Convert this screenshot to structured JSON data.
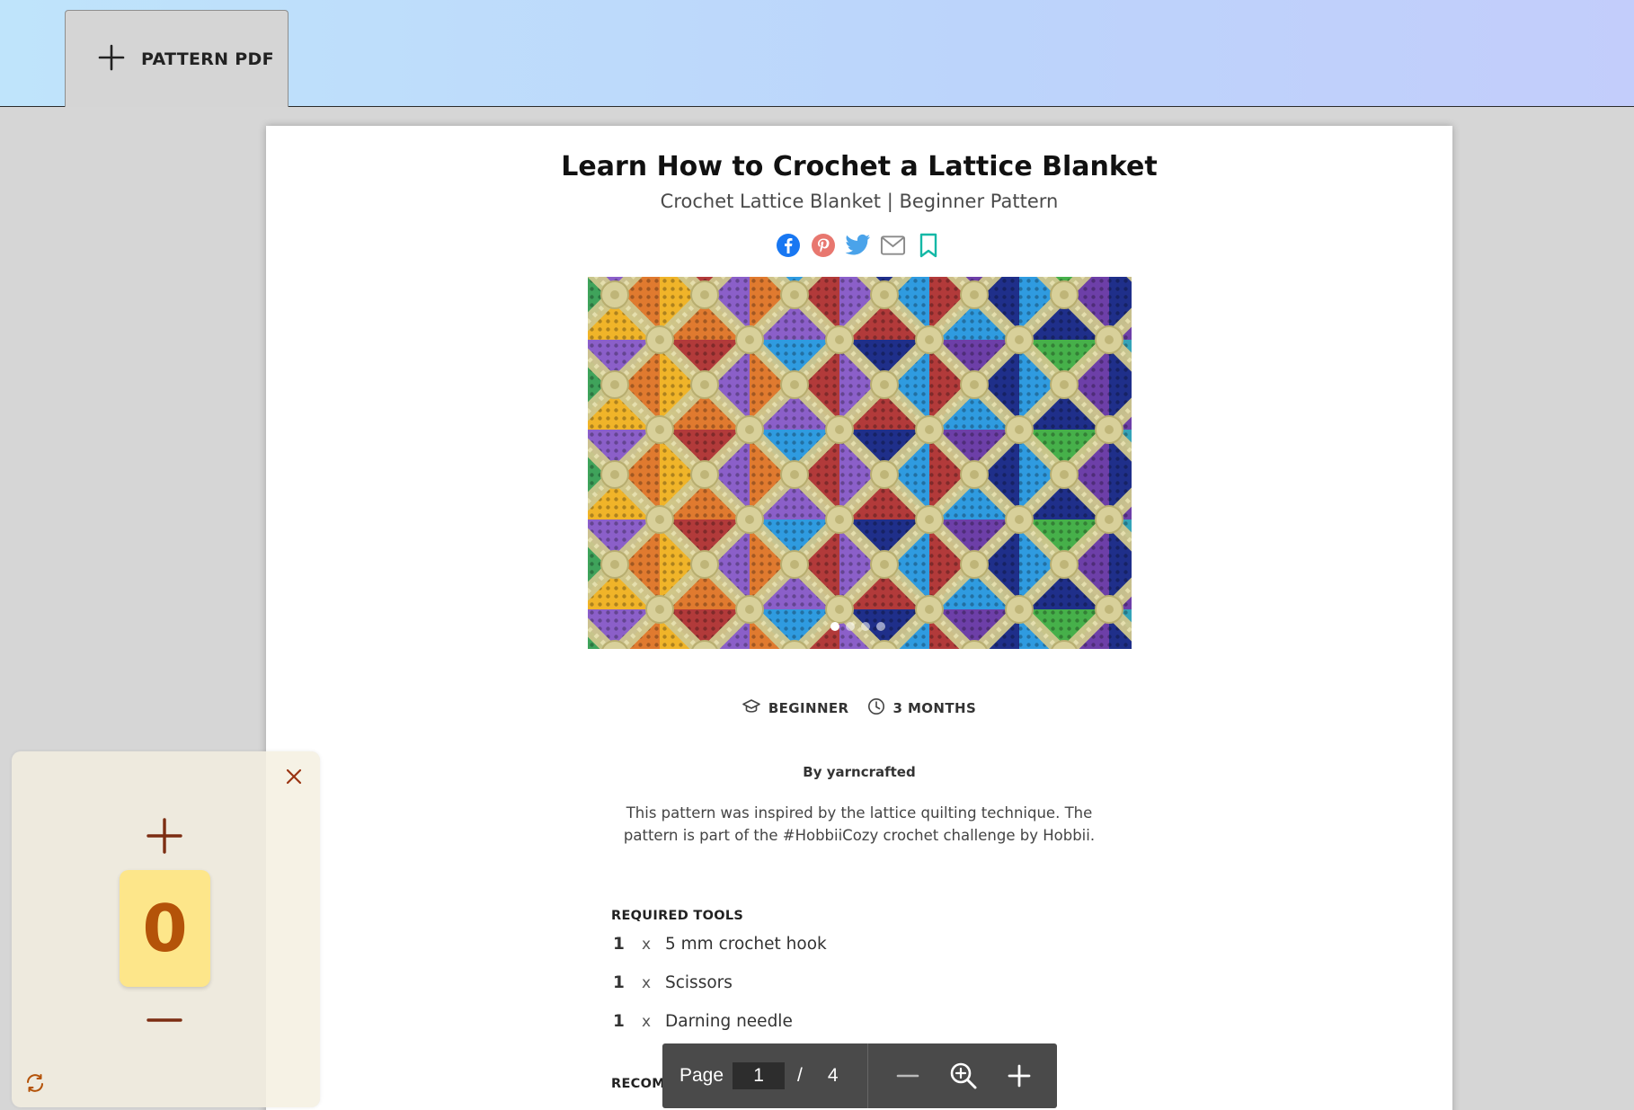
{
  "topbar": {
    "tab_label": "PATTERN PDF",
    "tab_icon": "plus-icon"
  },
  "document": {
    "title": "Learn How to Crochet a Lattice Blanket",
    "subtitle": "Crochet Lattice Blanket | Beginner Pattern",
    "share_icons": [
      "facebook-icon",
      "pinterest-icon",
      "twitter-icon",
      "email-icon",
      "bookmark-icon"
    ],
    "hero": {
      "image": "crochet lattice blanket photo",
      "slide_count": 4,
      "active_slide": 1
    },
    "meta": {
      "level": "BEGINNER",
      "duration": "3 MONTHS"
    },
    "byline": "By yarncrafted",
    "description": "This pattern was inspired by the lattice quilting technique. The pattern is part of the #HobbiiCozy crochet challenge by Hobbii.",
    "required_tools": {
      "heading": "REQUIRED TOOLS",
      "items": [
        {
          "qty": "1",
          "x": "x",
          "name": "5 mm crochet hook"
        },
        {
          "qty": "1",
          "x": "x",
          "name": "Scissors"
        },
        {
          "qty": "1",
          "x": "x",
          "name": "Darning needle"
        }
      ]
    },
    "recommended_yarn": {
      "heading": "RECOMMENDED YARN"
    }
  },
  "pdf_toolbar": {
    "page_label": "Page",
    "current_page": "1",
    "separator": "/",
    "total_pages": "4"
  },
  "counter": {
    "value": "0"
  },
  "colors": {
    "accent": "#b45309",
    "counter_bg": "#fde68a",
    "panel_bg": "#eeeade",
    "bookmark": "#14b8a6",
    "facebook": "#1877f2",
    "pinterest": "#e60023",
    "twitter": "#1d9bf0"
  }
}
